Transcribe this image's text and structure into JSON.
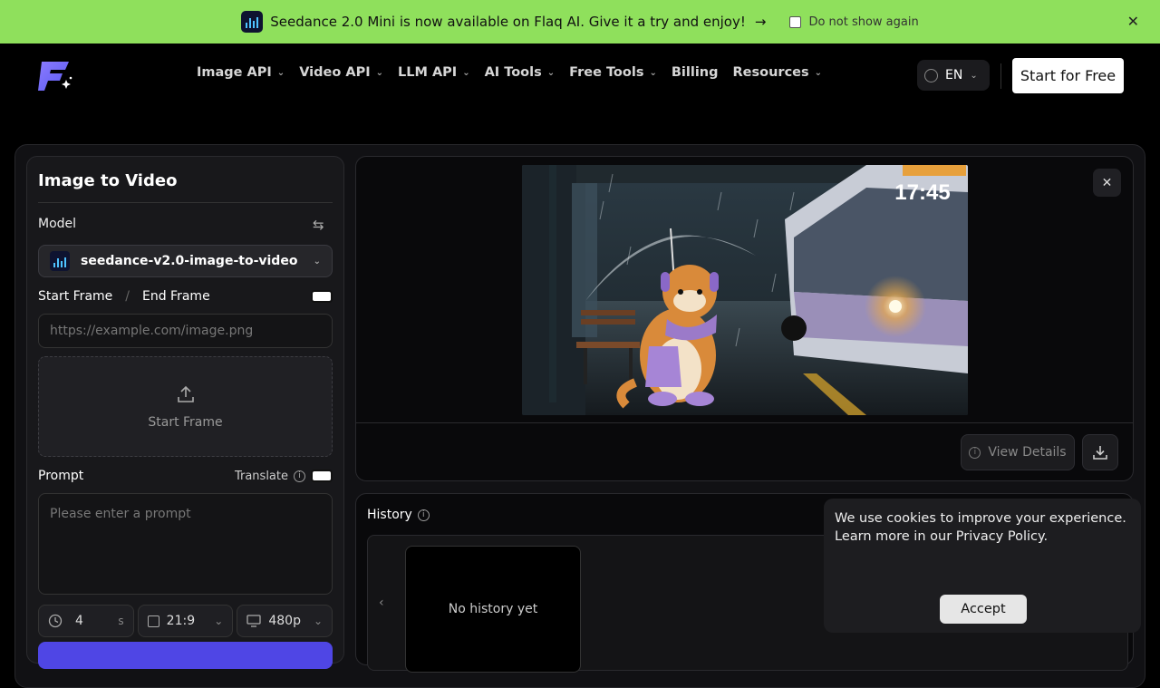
{
  "banner": {
    "message": "Seedance 2.0 Mini is now available on Flaq AI. Give it a try and enjoy!",
    "arrow": "→",
    "dont_show": "Do not show again",
    "close": "✕"
  },
  "nav": {
    "items": [
      {
        "label": "Image API",
        "dropdown": true
      },
      {
        "label": "Video API",
        "dropdown": true
      },
      {
        "label": "LLM API",
        "dropdown": true
      },
      {
        "label": "AI Tools",
        "dropdown": true
      },
      {
        "label": "Free Tools",
        "dropdown": true
      },
      {
        "label": "Billing",
        "dropdown": false
      },
      {
        "label": "Resources",
        "dropdown": true
      }
    ],
    "lang": "EN",
    "cta": "Start for Free"
  },
  "panel": {
    "title": "Image to Video",
    "model_label": "Model",
    "model_value": "seedance-v2.0-image-to-video",
    "start_frame_tab": "Start Frame",
    "separator": "/",
    "end_frame_tab": "End Frame",
    "url_placeholder": "https://example.com/image.png",
    "upload_label": "Start Frame",
    "prompt_label": "Prompt",
    "translate_label": "Translate",
    "prompt_placeholder": "Please enter a prompt",
    "duration_value": "4",
    "duration_unit": "s",
    "ratio_value": "21:9",
    "resolution_value": "480p"
  },
  "preview": {
    "clock": "17:45",
    "view_details": "View Details"
  },
  "history": {
    "title": "History",
    "empty": "No history yet"
  },
  "cookie": {
    "text": "We use cookies to improve your experience. Learn more in our Privacy Policy.",
    "accept": "Accept"
  },
  "colors": {
    "banner_bg": "#8fe05c",
    "accent": "#4f46e5",
    "brand": "#6e6cf5"
  }
}
